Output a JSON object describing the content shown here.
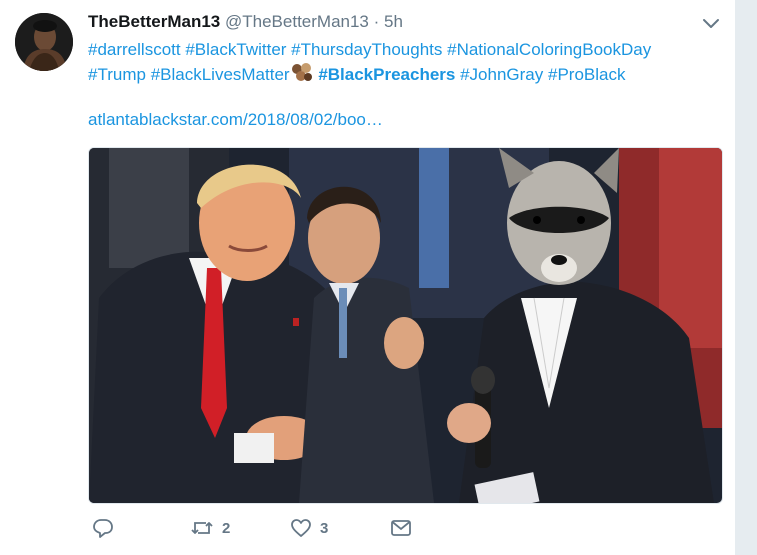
{
  "tweet": {
    "display_name": "TheBetterMan13",
    "handle": "@TheBetterMan13",
    "separator": "·",
    "time": "5h",
    "hashtags_line1": [
      "#darrellscott",
      "#BlackTwitter",
      "#ThursdayThoughts",
      "#NationalColoringBookDay"
    ],
    "hashtags_line2_a": [
      "#Trump",
      "#BlackLivesMatter"
    ],
    "hashtag_bold": "#BlackPreachers",
    "hashtags_line2_b": [
      "#JohnGray",
      "#ProBlack"
    ],
    "link": "atlantablackstar.com/2018/08/02/boo…",
    "emoji": "hands-emoji",
    "media_icon": "photo-image",
    "actions": {
      "reply_icon": "reply-icon",
      "retweet_icon": "retweet-icon",
      "retweet_count": "2",
      "like_icon": "heart-icon",
      "like_count": "3",
      "dm_icon": "envelope-icon"
    },
    "colors": {
      "link": "#1b95e0",
      "muted": "#657786",
      "name": "#14171a",
      "sidebar": "#e6ecf0"
    }
  }
}
